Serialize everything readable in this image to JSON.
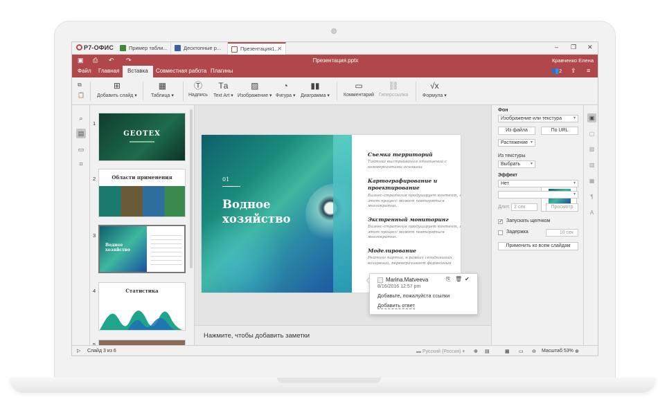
{
  "app": {
    "logo": "Р7-ОФИС"
  },
  "tabs": [
    {
      "label": "Пример табли...",
      "color": "#3b8a3e"
    },
    {
      "label": "Десктопные р...",
      "color": "#3b5fa0"
    },
    {
      "label": "Презентация1...",
      "color": "#b44a4a",
      "active": true
    }
  ],
  "window": {
    "minimize": "–",
    "maximize": "❐",
    "close": "✕"
  },
  "header": {
    "title": "Презентация.pptx",
    "user": "Кравченко Елена",
    "users_count": "2",
    "menu": [
      "Файл",
      "Главная",
      "Вставка",
      "Совместная работа",
      "Плагины"
    ],
    "active_menu": "Вставка"
  },
  "toolbar": {
    "add_slide": "Добавить слайд",
    "table": "Таблица",
    "textbox": "Надпись",
    "textart": "Text Art",
    "image": "Изображение",
    "shape": "Фигура",
    "chart": "Диаграмма",
    "comment": "Комментарий",
    "hyperlink": "Гиперссылка",
    "formula": "Формула"
  },
  "thumbnails": {
    "numbers": [
      "1",
      "2",
      "3",
      "4",
      "5"
    ],
    "t1_title": "GEOTEX",
    "t2_title": "Области применения",
    "t3_title": "Водное хозяйство",
    "t4_title": "Статистика"
  },
  "slide": {
    "number": "01",
    "title": "Водное хозяйство",
    "sections": [
      {
        "title": "Съемка территорий",
        "text": "Тактика выстраивания отношений с коммерсантами основана"
      },
      {
        "title": "Картографирование и проектирование",
        "text": "Бизнес-стратегия продуцирует контент, и этот процесс может повторяться многократно."
      },
      {
        "title": "Экстренный мониторинг",
        "text": "Бизнес-стратегия продуцирует контент, и этот процесс может повторяться многократно."
      },
      {
        "title": "Моделирование",
        "text": "Рейтинг партии, в рамках сегодняшних воззрений, переворачивает фирменный"
      }
    ]
  },
  "comment": {
    "user": "Marina.Matveeva",
    "date": "8/16/2016 12:57 pm",
    "text": "Добавьте, пожалуйста ссылки",
    "reply": "Добавить ответ"
  },
  "notes_placeholder": "Нажмите, чтобы добавить заметки",
  "settings": {
    "fill_label": "Фон",
    "fill_value": "Изображение или текстура",
    "from_file": "Из файла",
    "from_url": "По URL",
    "stretch": "Растяжение",
    "from_texture": "Из текстуры",
    "select": "Выбрать",
    "effect_label": "Эффект",
    "effect_value": "Нет",
    "duration_label": "Длит.",
    "duration_value": "2 сек",
    "preview": "Просмотр",
    "on_click": "Запускать щелчком",
    "delay": "Задержка",
    "delay_value": "10 сек",
    "apply_all": "Применить ко всем слайдам"
  },
  "status": {
    "slide_of": "Слайд 3 из 6",
    "language": "Русский (Россия)",
    "zoom": "Масштаб 53%"
  }
}
